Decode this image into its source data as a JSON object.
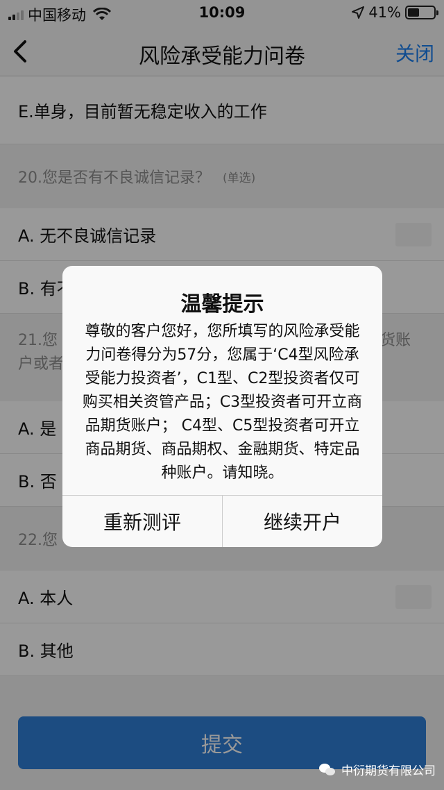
{
  "status_bar": {
    "carrier": "中国移动",
    "time": "10:09",
    "battery": "41%"
  },
  "nav": {
    "title": "风险承受能力问卷",
    "close_label": "关闭",
    "back_icon": "chevron-left-icon"
  },
  "questionnaire": {
    "prev_answer_e": "E.单身，目前暂无稳定收入的工作",
    "q20": {
      "text": "20.您是否有不良诚信记录？",
      "type": "(单选)",
      "option_a": "A.  无不良诚信记录",
      "option_b": "B. 有不"
    },
    "q21": {
      "text": "21.您",
      "text_line2": "户或者",
      "text_right": "货账",
      "option_a": "A.  是",
      "option_b": "B. 否"
    },
    "q22": {
      "text": "22.您",
      "option_a": "A.  本人",
      "option_b": "B. 其他"
    }
  },
  "submit_label": "提交",
  "dialog": {
    "title": "温馨提示",
    "message": "尊敬的客户您好，您所填写的风险承受能力问卷得分为57分，您属于‘C4型风险承受能力投资者’，C1型、C2型投资者仅可购买相关资管产品；C3型投资者可开立商品期货账户； C4型、C5型投资者可开立商品期货、商品期权、金融期货、特定品种账户。请知晓。",
    "retest_label": "重新测评",
    "continue_label": "继续开户"
  },
  "watermark": "中衍期货有限公司",
  "colors": {
    "accent": "#1a7ff0",
    "submit": "#2f7fd8",
    "overlay": "rgba(0,0,0,0.4)"
  }
}
